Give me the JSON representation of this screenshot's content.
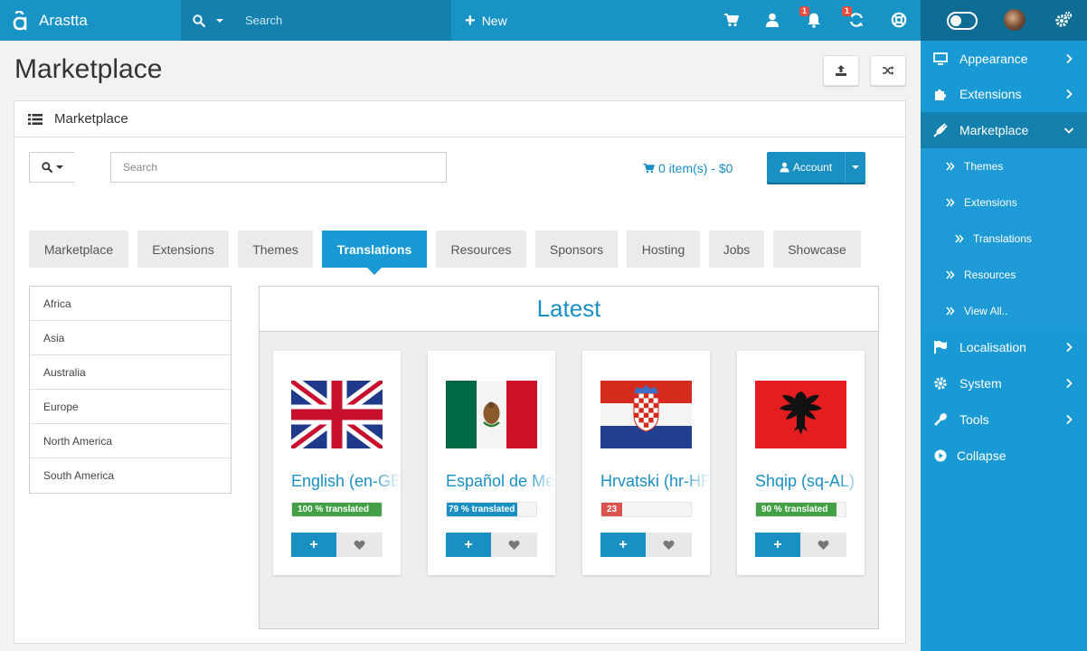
{
  "brand": {
    "name": "Arastta"
  },
  "topbar": {
    "search_placeholder": "Search",
    "new_label": "New",
    "notifications_badge": "1",
    "updates_badge": "1"
  },
  "page": {
    "title": "Marketplace"
  },
  "panel": {
    "heading": "Marketplace",
    "search_placeholder": "Search",
    "cart_text": "0 item(s) - $0",
    "account_label": "Account"
  },
  "tabs": [
    {
      "label": "Marketplace"
    },
    {
      "label": "Extensions"
    },
    {
      "label": "Themes"
    },
    {
      "label": "Translations",
      "active": true
    },
    {
      "label": "Resources"
    },
    {
      "label": "Sponsors"
    },
    {
      "label": "Hosting"
    },
    {
      "label": "Jobs"
    },
    {
      "label": "Showcase"
    }
  ],
  "regions": [
    "Africa",
    "Asia",
    "Australia",
    "Europe",
    "North America",
    "South America"
  ],
  "latest": {
    "heading": "Latest",
    "cards": [
      {
        "title": "English (en-GB)",
        "progress_label": "100 %  translated",
        "progress": 100,
        "progress_color": "green",
        "flag": "uk-flag"
      },
      {
        "title": "Español de México",
        "progress_label": "79 %  translated",
        "progress": 79,
        "progress_color": "blue",
        "flag": "mexico-flag"
      },
      {
        "title": "Hrvatski (hr-HR)",
        "progress_label": "23",
        "progress": 23,
        "progress_color": "red",
        "flag": "croatia-flag"
      },
      {
        "title": "Shqip (sq-AL)",
        "progress_label": "90 %  translated",
        "progress": 90,
        "progress_color": "green",
        "flag": "albania-flag"
      }
    ],
    "add_label": "+"
  },
  "sidebar": {
    "items": [
      {
        "label": "Appearance",
        "icon": "monitor-icon"
      },
      {
        "label": "Extensions",
        "icon": "puzzle-icon"
      },
      {
        "label": "Marketplace",
        "icon": "plug-icon",
        "active": true
      }
    ],
    "subitems": [
      {
        "label": "Themes"
      },
      {
        "label": "Extensions"
      },
      {
        "label": "Translations"
      },
      {
        "label": "Resources"
      },
      {
        "label": "View All.."
      }
    ],
    "items_after": [
      {
        "label": "Localisation",
        "icon": "flag-icon"
      },
      {
        "label": "System",
        "icon": "cog-icon"
      },
      {
        "label": "Tools",
        "icon": "wrench-icon"
      }
    ],
    "collapse_label": "Collapse"
  },
  "colors": {
    "topbar": "#1793c6",
    "sidebar": "#1a9ad4",
    "accent": "#1a8fc2",
    "success": "#43a047",
    "danger": "#d9534f"
  }
}
